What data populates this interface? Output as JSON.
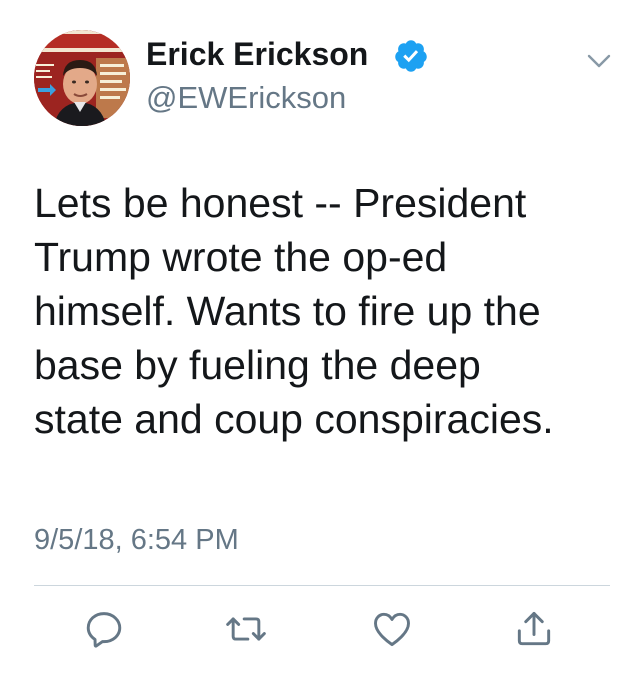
{
  "tweet": {
    "author": {
      "display_name": "Erick Erickson",
      "handle": "@EWErickson",
      "verified": true,
      "avatar_icon": "profile-photo"
    },
    "text": "Lets be honest -- President\nTrump wrote the op-ed\nhimself.  Wants to fire up the\nbase by fueling the deep\nstate and coup conspiracies.",
    "timestamp": "9/5/18, 6:54 PM",
    "actions": [
      {
        "name": "reply",
        "icon": "reply-icon"
      },
      {
        "name": "retweet",
        "icon": "retweet-icon"
      },
      {
        "name": "like",
        "icon": "heart-icon"
      },
      {
        "name": "share",
        "icon": "share-icon"
      }
    ]
  },
  "colors": {
    "text_primary": "#14171a",
    "text_secondary": "#657786",
    "verified_blue": "#1da1f2",
    "divider": "#ccd6dd"
  }
}
